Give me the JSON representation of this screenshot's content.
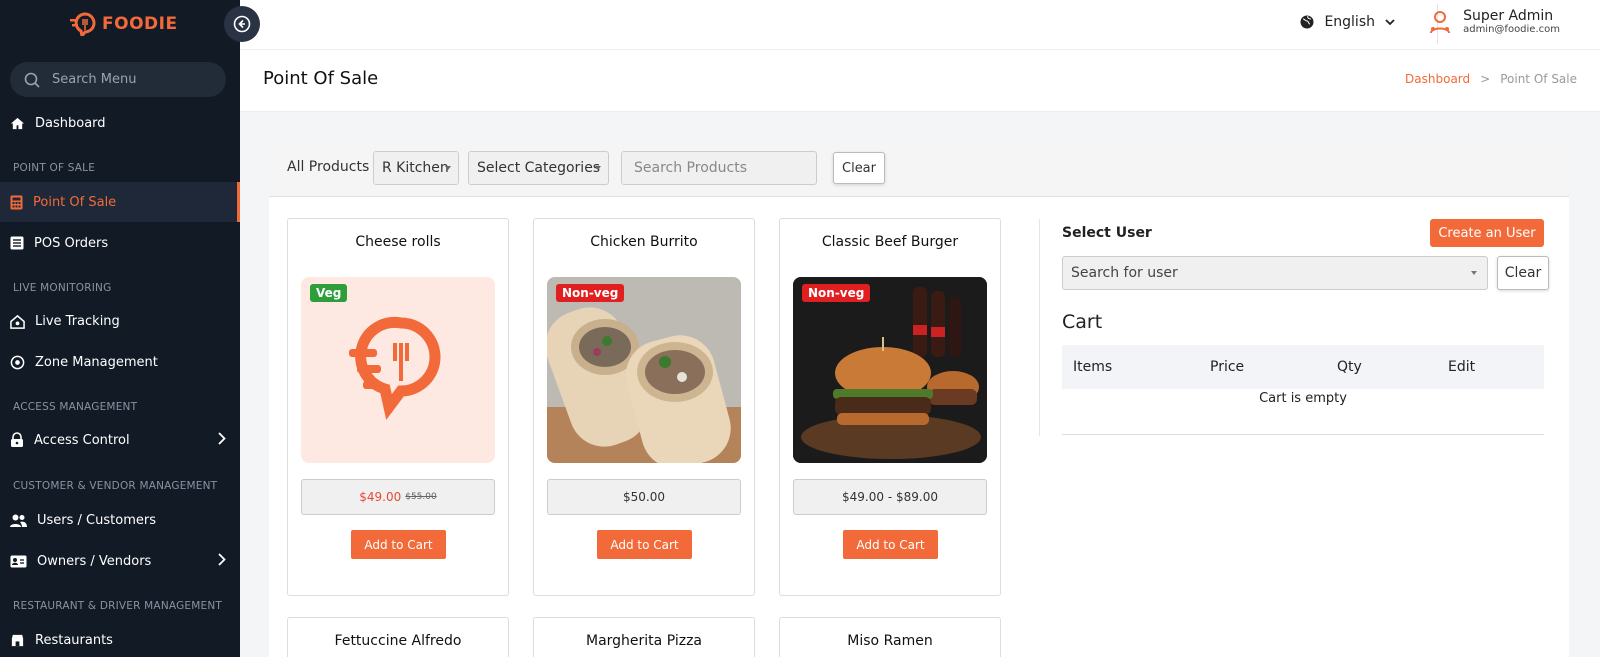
{
  "brand": {
    "name": "FOODIE",
    "accent": "#f26a3a"
  },
  "sidebar": {
    "search_placeholder": "Search Menu",
    "items": {
      "dashboard": "Dashboard",
      "section_pos": "POINT OF SALE",
      "pos": "Point Of Sale",
      "pos_orders": "POS Orders",
      "section_live": "LIVE MONITORING",
      "live_tracking": "Live Tracking",
      "zone_mgmt": "Zone Management",
      "section_access": "ACCESS MANAGEMENT",
      "access_control": "Access Control",
      "section_customer": "CUSTOMER & VENDOR MANAGEMENT",
      "users_customers": "Users / Customers",
      "owners_vendors": "Owners / Vendors",
      "section_restaurant": "RESTAURANT & DRIVER MANAGEMENT",
      "restaurants": "Restaurants"
    }
  },
  "topbar": {
    "language": "English",
    "user_name": "Super Admin",
    "user_email": "admin@foodie.com"
  },
  "page": {
    "title": "Point Of Sale",
    "breadcrumb_home": "Dashboard",
    "breadcrumb_sep": ">",
    "breadcrumb_current": "Point Of Sale"
  },
  "filters": {
    "all_products": "All Products",
    "kitchen": "R Kitchen",
    "categories": "Select Categories",
    "search_placeholder": "Search Products",
    "clear": "Clear"
  },
  "products": [
    {
      "name": "Cheese rolls",
      "tag": "Veg",
      "price": "$49.00",
      "old_price": "$55.00",
      "button": "Add to Cart"
    },
    {
      "name": "Chicken Burrito",
      "tag": "Non-veg",
      "price": "$50.00",
      "button": "Add to Cart"
    },
    {
      "name": "Classic Beef Burger",
      "tag": "Non-veg",
      "price": "$49.00 - $89.00",
      "button": "Add to Cart"
    }
  ],
  "products_row2": [
    {
      "name": "Fettuccine Alfredo"
    },
    {
      "name": "Margherita Pizza"
    },
    {
      "name": "Miso Ramen"
    }
  ],
  "cart": {
    "select_user": "Select User",
    "create_user": "Create an User",
    "user_placeholder": "Search for user",
    "clear": "Clear",
    "title": "Cart",
    "columns": [
      "Items",
      "Price",
      "Qty",
      "Edit"
    ],
    "empty": "Cart is empty"
  }
}
